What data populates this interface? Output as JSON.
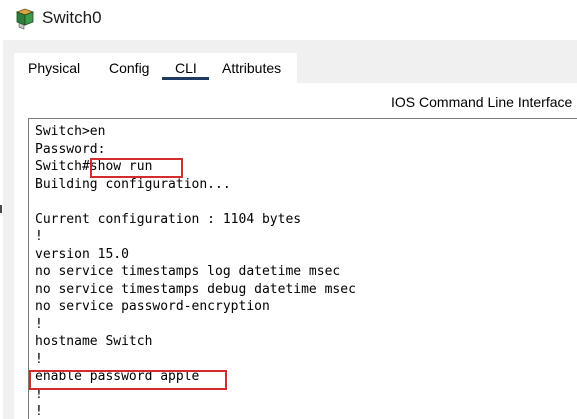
{
  "window": {
    "title": "Switch0",
    "icon": "switch-device-icon"
  },
  "tabs": [
    {
      "label": "Physical",
      "active": false
    },
    {
      "label": "Config",
      "active": false
    },
    {
      "label": "CLI",
      "active": true
    },
    {
      "label": "Attributes",
      "active": false
    }
  ],
  "cli": {
    "header": "IOS Command Line Interface",
    "lines": [
      "Switch>en",
      "Password:",
      "Switch#show run",
      "Building configuration...",
      "",
      "Current configuration : 1104 bytes",
      "!",
      "version 15.0",
      "no service timestamps log datetime msec",
      "no service timestamps debug datetime msec",
      "no service password-encryption",
      "!",
      "hostname Switch",
      "!",
      "enable password apple",
      "!",
      "!"
    ]
  },
  "colors": {
    "highlight": "#d62b2b",
    "active_tab_underline": "#1f3a5f"
  }
}
